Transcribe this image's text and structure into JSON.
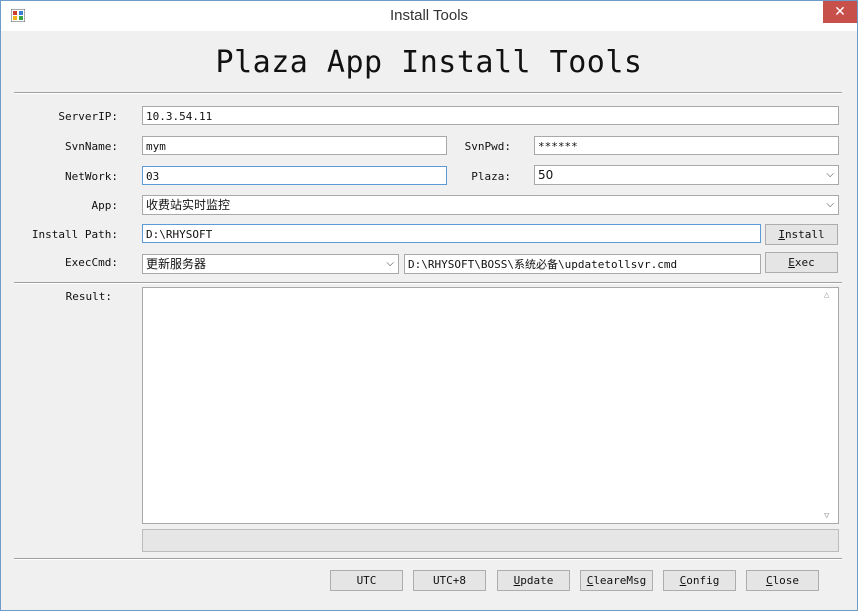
{
  "window": {
    "title": "Install Tools",
    "close_glyph": "✕"
  },
  "banner": "Plaza App Install Tools",
  "form": {
    "server_ip": {
      "label": "ServerIP:",
      "value": "10.3.54.11"
    },
    "svn_name": {
      "label": "SvnName:",
      "value": "mym"
    },
    "svn_pwd": {
      "label": "SvnPwd:",
      "value": "******"
    },
    "network": {
      "label": "NetWork:",
      "value": "03"
    },
    "plaza": {
      "label": "Plaza:",
      "value": "50"
    },
    "app": {
      "label": "App:",
      "value": "收费站实时监控"
    },
    "install_path": {
      "label": "Install Path:",
      "value": "D:\\RHYSOFT"
    },
    "exec_cmd": {
      "label": "ExecCmd:",
      "selected": "更新服务器",
      "command": "D:\\RHYSOFT\\BOSS\\系统必备\\updatetollsvr.cmd"
    }
  },
  "buttons": {
    "install": {
      "mnemonic": "I",
      "rest": "nstall"
    },
    "exec": {
      "mnemonic": "E",
      "rest": "xec"
    },
    "utc": "UTC",
    "utc8": "UTC+8",
    "update": {
      "mnemonic": "U",
      "rest": "pdate"
    },
    "clear": {
      "mnemonic": "C",
      "rest": "leareMsg"
    },
    "config": {
      "mnemonic": "C",
      "rest": "onfig"
    },
    "close": {
      "mnemonic": "C",
      "rest": "lose"
    }
  },
  "result": {
    "label": "Result:",
    "text": ""
  },
  "progress": {
    "value": 0
  },
  "icons": {
    "app": "app-window-icon",
    "dropdown": "chevron-down-icon",
    "scroll_up": "scroll-up-icon",
    "scroll_down": "scroll-down-icon"
  }
}
